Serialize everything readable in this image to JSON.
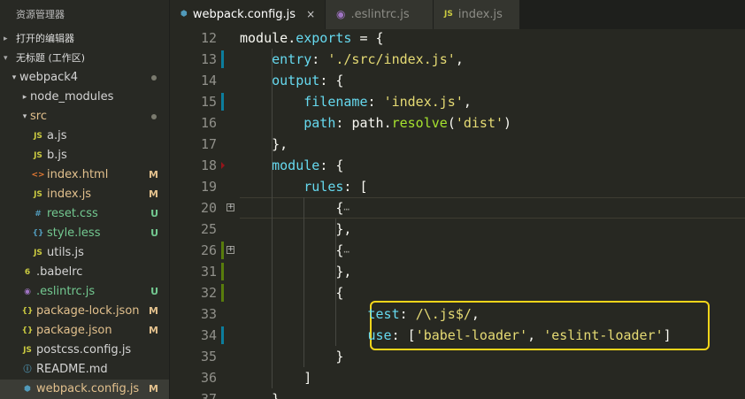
{
  "sidebar": {
    "header": "资源管理器",
    "open_editors": "打开的编辑器",
    "workspace": "无标题 (工作区)",
    "items": [
      {
        "name": "webpack4",
        "indent": 0,
        "arrow": "▾",
        "icon": "",
        "icon_class": "",
        "name_class": "",
        "badge": "",
        "dot": true
      },
      {
        "name": "node_modules",
        "indent": 1,
        "arrow": "▸",
        "icon": "",
        "icon_class": "",
        "name_class": "",
        "badge": "",
        "dot": false
      },
      {
        "name": "src",
        "indent": 1,
        "arrow": "▾",
        "icon": "",
        "icon_class": "",
        "name_class": "mod",
        "badge": "",
        "dot": true
      },
      {
        "name": "a.js",
        "indent": 2,
        "arrow": "",
        "icon": "JS",
        "icon_class": "ico-js",
        "name_class": "",
        "badge": "",
        "dot": false
      },
      {
        "name": "b.js",
        "indent": 2,
        "arrow": "",
        "icon": "JS",
        "icon_class": "ico-js",
        "name_class": "",
        "badge": "",
        "dot": false
      },
      {
        "name": "index.html",
        "indent": 2,
        "arrow": "",
        "icon": "<>",
        "icon_class": "ico-html",
        "name_class": "mod",
        "badge": "M",
        "dot": false
      },
      {
        "name": "index.js",
        "indent": 2,
        "arrow": "",
        "icon": "JS",
        "icon_class": "ico-js",
        "name_class": "mod",
        "badge": "M",
        "dot": false
      },
      {
        "name": "reset.css",
        "indent": 2,
        "arrow": "",
        "icon": "#",
        "icon_class": "ico-css",
        "name_class": "untr",
        "badge": "U",
        "dot": false
      },
      {
        "name": "style.less",
        "indent": 2,
        "arrow": "",
        "icon": "{}",
        "icon_class": "ico-less",
        "name_class": "untr",
        "badge": "U",
        "dot": false
      },
      {
        "name": "utils.js",
        "indent": 2,
        "arrow": "",
        "icon": "JS",
        "icon_class": "ico-js",
        "name_class": "",
        "badge": "",
        "dot": false
      },
      {
        "name": ".babelrc",
        "indent": 1,
        "arrow": "",
        "icon": "6",
        "icon_class": "ico-babel",
        "name_class": "",
        "badge": "",
        "dot": false
      },
      {
        "name": ".eslintrc.js",
        "indent": 1,
        "arrow": "",
        "icon": "◉",
        "icon_class": "ico-eslint",
        "name_class": "untr",
        "badge": "U",
        "dot": false
      },
      {
        "name": "package-lock.json",
        "indent": 1,
        "arrow": "",
        "icon": "{}",
        "icon_class": "ico-json",
        "name_class": "mod",
        "badge": "M",
        "dot": false
      },
      {
        "name": "package.json",
        "indent": 1,
        "arrow": "",
        "icon": "{}",
        "icon_class": "ico-json",
        "name_class": "mod",
        "badge": "M",
        "dot": false
      },
      {
        "name": "postcss.config.js",
        "indent": 1,
        "arrow": "",
        "icon": "JS",
        "icon_class": "ico-js",
        "name_class": "",
        "badge": "",
        "dot": false
      },
      {
        "name": "README.md",
        "indent": 1,
        "arrow": "",
        "icon": "ⓘ",
        "icon_class": "ico-info",
        "name_class": "",
        "badge": "",
        "dot": false
      },
      {
        "name": "webpack.config.js",
        "indent": 1,
        "arrow": "",
        "icon": "⬢",
        "icon_class": "ico-webpack",
        "name_class": "mod",
        "badge": "M",
        "dot": false,
        "selected": true
      }
    ]
  },
  "tabs": [
    {
      "label": "webpack.config.js",
      "icon": "⬢",
      "active": true,
      "close": "×"
    },
    {
      "label": ".eslintrc.js",
      "icon": "◉",
      "active": false
    },
    {
      "label": "index.js",
      "icon": "JS",
      "active": false
    }
  ],
  "editor": {
    "lines": [
      {
        "n": "12",
        "code": [
          [
            "k-pl",
            "module"
          ],
          [
            "k-pl",
            "."
          ],
          [
            "k-prop",
            "exports"
          ],
          [
            "k-pl",
            " = {"
          ]
        ]
      },
      {
        "n": "13",
        "mark": "blue",
        "code": [
          [
            "k-pl",
            "    "
          ],
          [
            "k-prop",
            "entry"
          ],
          [
            "k-pl",
            ": "
          ],
          [
            "k-str",
            "'./src/index.js'"
          ],
          [
            "k-pl",
            ","
          ]
        ]
      },
      {
        "n": "14",
        "code": [
          [
            "k-pl",
            "    "
          ],
          [
            "k-prop",
            "output"
          ],
          [
            "k-pl",
            ": {"
          ]
        ]
      },
      {
        "n": "15",
        "mark": "blue",
        "code": [
          [
            "k-pl",
            "        "
          ],
          [
            "k-prop",
            "filename"
          ],
          [
            "k-pl",
            ": "
          ],
          [
            "k-str",
            "'index.js'"
          ],
          [
            "k-pl",
            ","
          ]
        ]
      },
      {
        "n": "16",
        "code": [
          [
            "k-pl",
            "        "
          ],
          [
            "k-prop",
            "path"
          ],
          [
            "k-pl",
            ": "
          ],
          [
            "k-pl",
            "path"
          ],
          [
            "k-pl",
            "."
          ],
          [
            "k-fn",
            "resolve"
          ],
          [
            "k-pl",
            "("
          ],
          [
            "k-str",
            "'dist'"
          ],
          [
            "k-pl",
            ")"
          ]
        ]
      },
      {
        "n": "17",
        "code": [
          [
            "k-pl",
            "    },"
          ]
        ]
      },
      {
        "n": "18",
        "mark": "red",
        "code": [
          [
            "k-pl",
            "    "
          ],
          [
            "k-prop",
            "module"
          ],
          [
            "k-pl",
            ": {"
          ]
        ]
      },
      {
        "n": "19",
        "code": [
          [
            "k-pl",
            "        "
          ],
          [
            "k-prop",
            "rules"
          ],
          [
            "k-pl",
            ": ["
          ]
        ]
      },
      {
        "n": "20",
        "fold": "+",
        "cursor": true,
        "code": [
          [
            "k-pl",
            "            {"
          ],
          [
            "ellipsis",
            "⋯"
          ]
        ]
      },
      {
        "n": "25",
        "code": [
          [
            "k-pl",
            "            },"
          ]
        ]
      },
      {
        "n": "26",
        "mark": "green",
        "fold": "+",
        "code": [
          [
            "k-pl",
            "            {"
          ],
          [
            "ellipsis",
            "⋯"
          ]
        ]
      },
      {
        "n": "31",
        "mark": "green",
        "code": [
          [
            "k-pl",
            "            },"
          ]
        ]
      },
      {
        "n": "32",
        "mark": "green",
        "code": [
          [
            "k-pl",
            "            {"
          ]
        ]
      },
      {
        "n": "33",
        "code": [
          [
            "k-pl",
            "                "
          ],
          [
            "k-prop",
            "test"
          ],
          [
            "k-pl",
            ": "
          ],
          [
            "k-regex",
            "/\\.js$/"
          ],
          [
            "k-pl",
            ","
          ]
        ]
      },
      {
        "n": "34",
        "mark": "blue",
        "code": [
          [
            "k-pl",
            "                "
          ],
          [
            "k-prop",
            "use"
          ],
          [
            "k-pl",
            ": ["
          ],
          [
            "k-str",
            "'babel-loader'"
          ],
          [
            "k-pl",
            ", "
          ],
          [
            "k-str",
            "'eslint-loader'"
          ],
          [
            "k-pl",
            "]"
          ]
        ]
      },
      {
        "n": "35",
        "code": [
          [
            "k-pl",
            "            }"
          ]
        ]
      },
      {
        "n": "36",
        "code": [
          [
            "k-pl",
            "        ]"
          ]
        ]
      },
      {
        "n": "37",
        "code": [
          [
            "k-pl",
            "    }"
          ]
        ]
      }
    ]
  }
}
